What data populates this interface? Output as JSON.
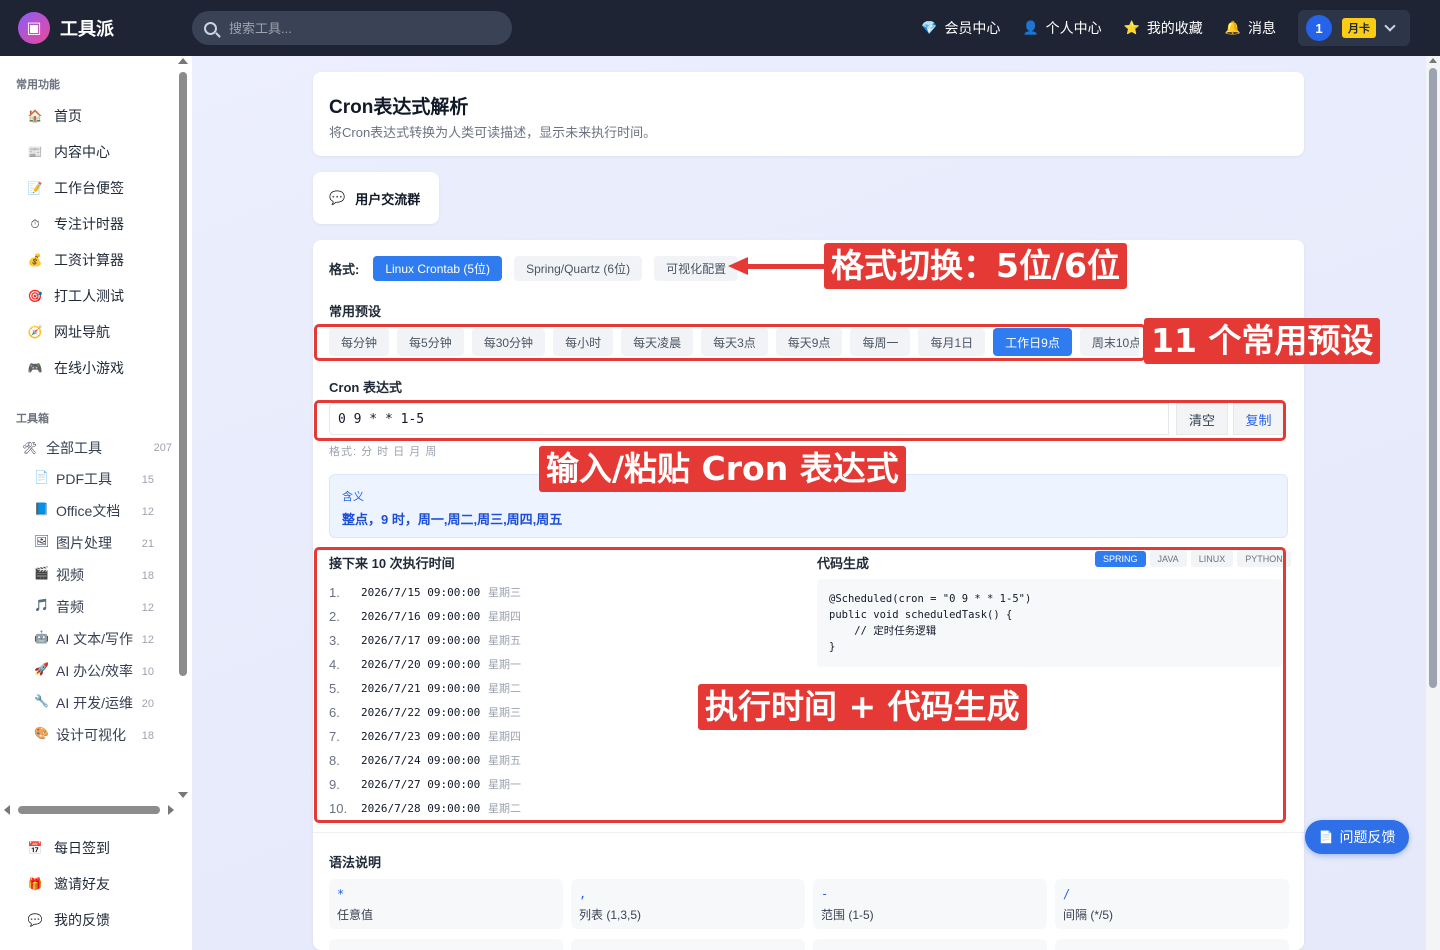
{
  "app": {
    "name": "工具派",
    "logo_icon": "▣"
  },
  "search": {
    "placeholder": "搜索工具..."
  },
  "topnav": {
    "vip": "会员中心",
    "vip_icon": "💎",
    "profile": "个人中心",
    "profile_icon": "👤",
    "favorites": "我的收藏",
    "favorites_icon": "⭐",
    "messages": "消息",
    "messages_icon": "🔔",
    "avatar": "1",
    "plan": "月卡"
  },
  "sidebar": {
    "common_title": "常用功能",
    "common": [
      {
        "icon": "🏠",
        "label": "首页"
      },
      {
        "icon": "📰",
        "label": "内容中心"
      },
      {
        "icon": "📝",
        "label": "工作台便签"
      },
      {
        "icon": "⏱",
        "label": "专注计时器"
      },
      {
        "icon": "💰",
        "label": "工资计算器"
      },
      {
        "icon": "🎯",
        "label": "打工人测试"
      },
      {
        "icon": "🧭",
        "label": "网址导航"
      },
      {
        "icon": "🎮",
        "label": "在线小游戏"
      }
    ],
    "toolbox_title": "工具箱",
    "all_tools": {
      "icon": "🛠",
      "label": "全部工具",
      "count": "207"
    },
    "categories": [
      {
        "icon": "📄",
        "label": "PDF工具",
        "count": "15"
      },
      {
        "icon": "📘",
        "label": "Office文档",
        "count": "12"
      },
      {
        "icon": "🖼",
        "label": "图片处理",
        "count": "21"
      },
      {
        "icon": "🎬",
        "label": "视频",
        "count": "18"
      },
      {
        "icon": "🎵",
        "label": "音频",
        "count": "12"
      },
      {
        "icon": "🤖",
        "label": "AI 文本/写作",
        "count": "12"
      },
      {
        "icon": "🚀",
        "label": "AI 办公/效率",
        "count": "10"
      },
      {
        "icon": "🔧",
        "label": "AI 开发/运维",
        "count": "20"
      },
      {
        "icon": "🎨",
        "label": "设计可视化",
        "count": "18"
      }
    ],
    "bottom": [
      {
        "icon": "📅",
        "label": "每日签到"
      },
      {
        "icon": "🎁",
        "label": "邀请好友"
      },
      {
        "icon": "💬",
        "label": "我的反馈"
      }
    ]
  },
  "page": {
    "title": "Cron表达式解析",
    "subtitle": "将Cron表达式转换为人类可读描述，显示未来执行时间。",
    "group_icon": "💬",
    "group_label": "用户交流群"
  },
  "tool": {
    "format_label": "格式:",
    "formats": [
      "Linux Crontab (5位)",
      "Spring/Quartz (6位)",
      "可视化配置"
    ],
    "presets_title": "常用预设",
    "presets": [
      "每分钟",
      "每5分钟",
      "每30分钟",
      "每小时",
      "每天凌晨",
      "每天3点",
      "每天9点",
      "每周一",
      "每月1日",
      "工作日9点",
      "周末10点"
    ],
    "expr_title": "Cron 表达式",
    "expr_value": "0 9 * * 1-5",
    "clear": "清空",
    "copy": "复制",
    "format_hint": "格式: 分 时 日 月 周",
    "meaning_label": "含义",
    "meaning_value": "整点，9 时，周一,周二,周三,周四,周五",
    "next_title": "接下来 10 次执行时间",
    "next_runs": [
      {
        "n": "1.",
        "time": "2026/7/15 09:00:00",
        "weekday": "星期三"
      },
      {
        "n": "2.",
        "time": "2026/7/16 09:00:00",
        "weekday": "星期四"
      },
      {
        "n": "3.",
        "time": "2026/7/17 09:00:00",
        "weekday": "星期五"
      },
      {
        "n": "4.",
        "time": "2026/7/20 09:00:00",
        "weekday": "星期一"
      },
      {
        "n": "5.",
        "time": "2026/7/21 09:00:00",
        "weekday": "星期二"
      },
      {
        "n": "6.",
        "time": "2026/7/22 09:00:00",
        "weekday": "星期三"
      },
      {
        "n": "7.",
        "time": "2026/7/23 09:00:00",
        "weekday": "星期四"
      },
      {
        "n": "8.",
        "time": "2026/7/24 09:00:00",
        "weekday": "星期五"
      },
      {
        "n": "9.",
        "time": "2026/7/27 09:00:00",
        "weekday": "星期一"
      },
      {
        "n": "10.",
        "time": "2026/7/28 09:00:00",
        "weekday": "星期二"
      }
    ],
    "code_title": "代码生成",
    "code_tabs": [
      "SPRING",
      "JAVA",
      "LINUX",
      "PYTHON"
    ],
    "code": "@Scheduled(cron = \"0 9 * * 1-5\")\npublic void scheduledTask() {\n    // 定时任务逻辑\n}",
    "syntax_title": "语法说明",
    "syntax": [
      {
        "sym": "*",
        "desc": "任意值"
      },
      {
        "sym": ",",
        "desc": "列表 (1,3,5)"
      },
      {
        "sym": "-",
        "desc": "范围 (1-5)"
      },
      {
        "sym": "/",
        "desc": "间隔 (*/5)"
      }
    ]
  },
  "annotations": {
    "format_switch": "格式切换：5位/6位",
    "presets": "11 个常用预设",
    "input": "输入/粘贴 Cron 表达式",
    "output": "执行时间 + 代码生成",
    "color": "#e53935"
  },
  "feedback": {
    "icon": "📄",
    "label": "问题反馈"
  },
  "colors": {
    "accent": "#2f7bf0",
    "topbar": "#1e2433",
    "annotation": "#e53935"
  }
}
